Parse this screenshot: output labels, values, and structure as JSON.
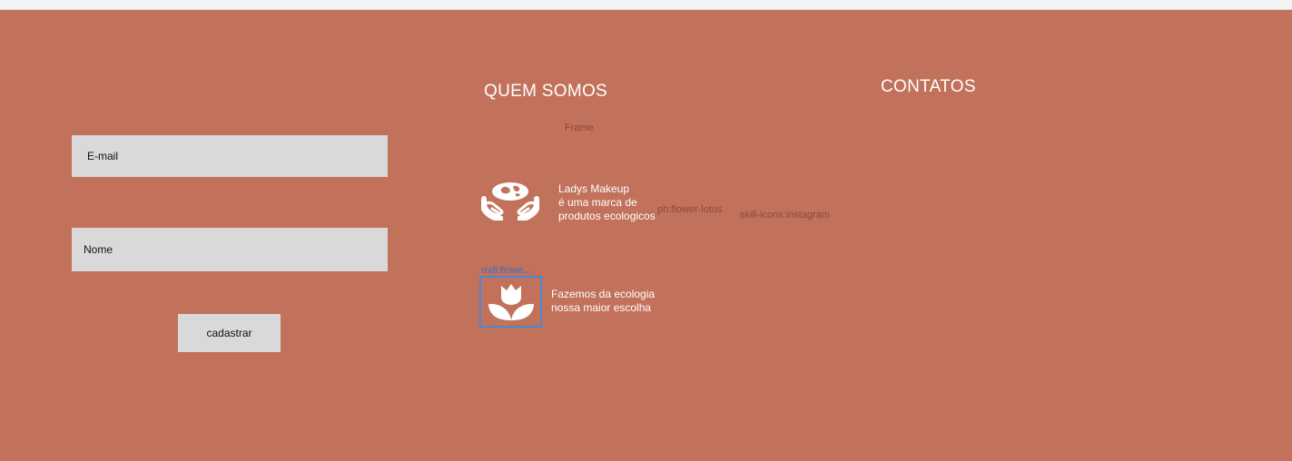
{
  "form": {
    "email_placeholder": "E-mail",
    "name_placeholder": "Nome",
    "submit_label": "cadastrar"
  },
  "about": {
    "heading": "QUEM SOMOS",
    "frame_label": "Frame",
    "lotus_label": "ph:flower-lotus",
    "instagram_label": "skill-icons:instagram",
    "mdi_label": "mdi:flowe...",
    "brand_lines": [
      "Ladys Makeup",
      "é uma marca de",
      "produtos ecologicos"
    ],
    "eco_lines": [
      "Fazemos da ecologia",
      "nossa maior escolha"
    ],
    "hands_icon": "hands-globe-icon",
    "flower_icon": "flower-tulip-icon"
  },
  "contacts": {
    "heading": "CONTATOS"
  },
  "colors": {
    "background": "#c2715b",
    "field": "#d9d9d9",
    "selection": "#4a88d6"
  }
}
